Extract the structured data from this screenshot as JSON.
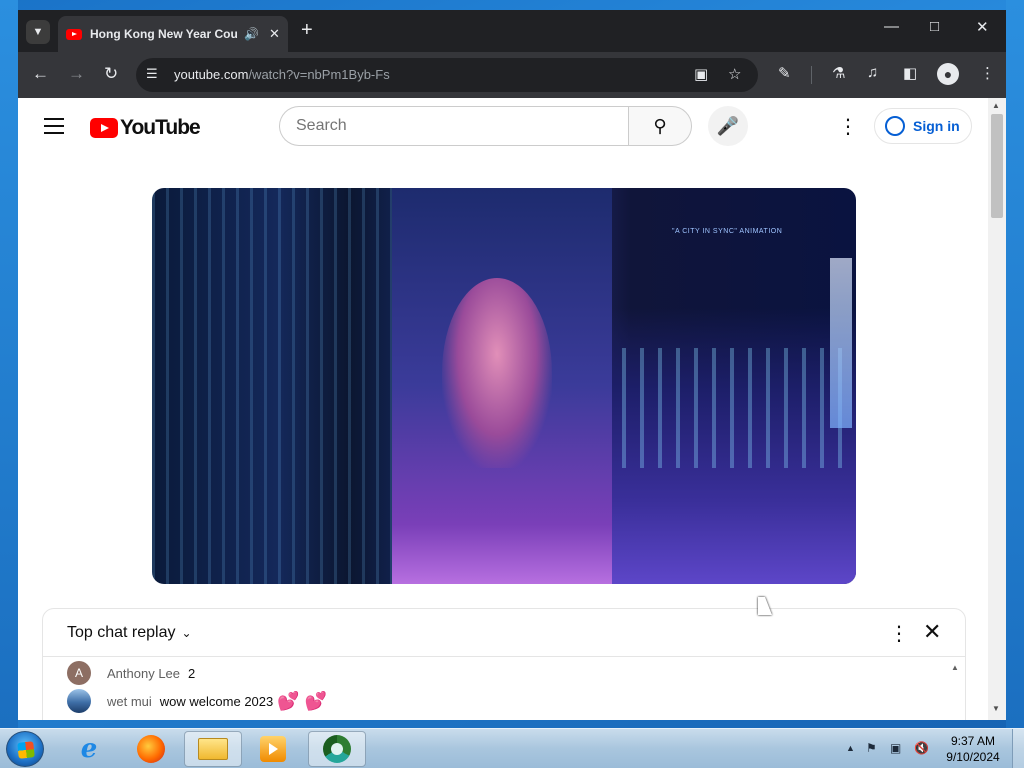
{
  "browser": {
    "tab_title": "Hong Kong New Year Coun",
    "url_host": "youtube.com",
    "url_path": "/watch?v=nbPm1Byb-Fs"
  },
  "youtube": {
    "logo_text": "YouTube",
    "search_placeholder": "Search",
    "sign_in_label": "Sign in"
  },
  "video": {
    "overlay_caption": "\"A CITY IN SYNC\" ANIMATION"
  },
  "chat": {
    "mode_label": "Top chat replay",
    "messages": [
      {
        "avatar_letter": "A",
        "avatar_color": "#8d6e63",
        "author": "Anthony Lee",
        "text": "2"
      },
      {
        "avatar_letter": "",
        "avatar_color": "#3f6fa8",
        "author": "wet mui",
        "text": "wow welcome 2023",
        "emoji": "💕 💕"
      }
    ]
  },
  "taskbar": {
    "time": "9:37 AM",
    "date": "9/10/2024"
  },
  "colors": {
    "yt_red": "#ff0000",
    "link_blue": "#065fd4",
    "chrome_dark": "#202124"
  }
}
